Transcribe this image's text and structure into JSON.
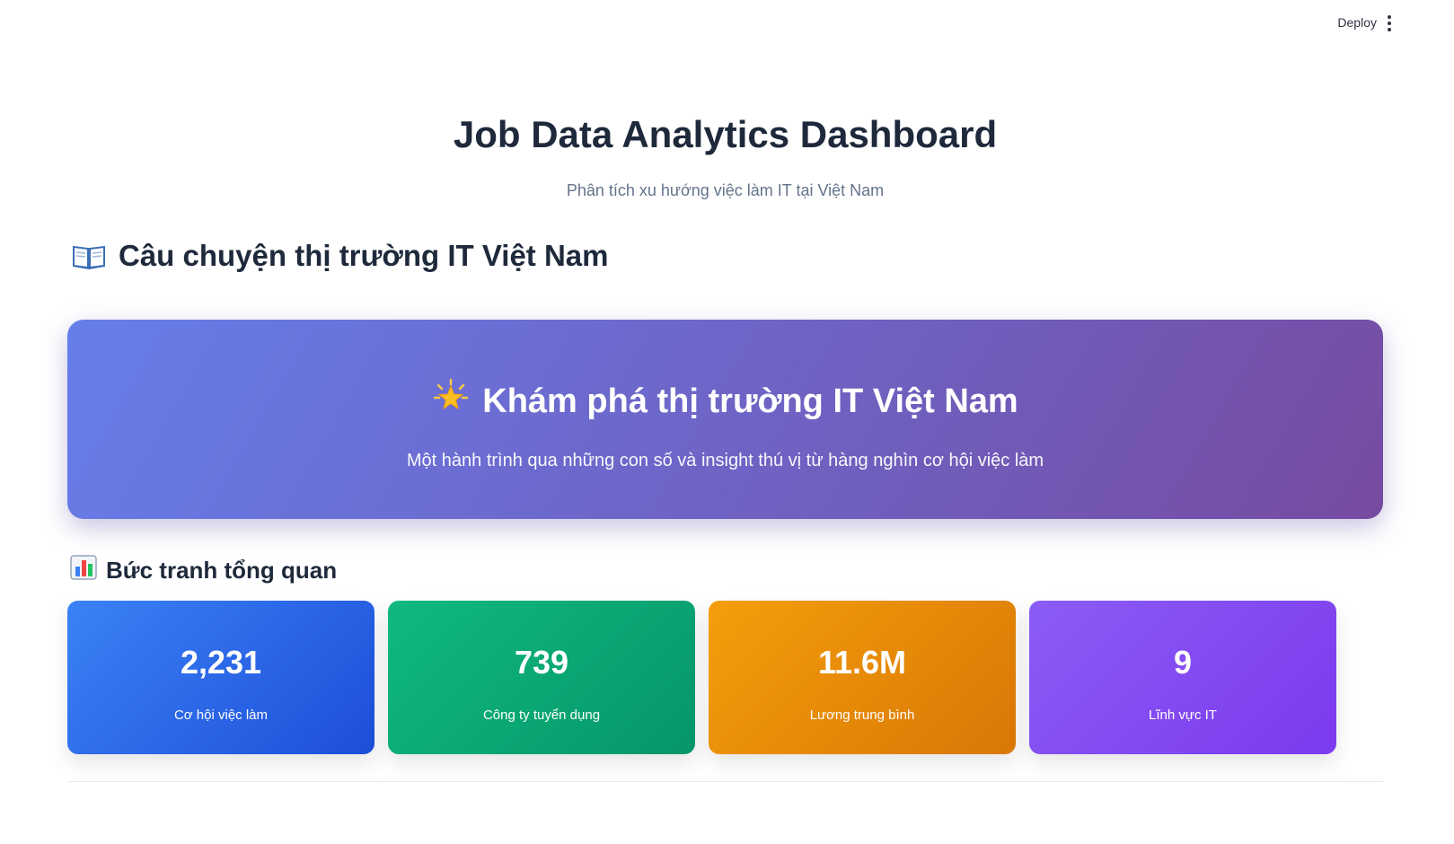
{
  "toolbar": {
    "deploy_label": "Deploy"
  },
  "header": {
    "title": "Job Data Analytics Dashboard",
    "subtitle": "Phân tích xu hướng việc làm IT tại Việt Nam"
  },
  "story_section": {
    "icon": "open-book-icon",
    "title": "Câu chuyện thị trường IT Việt Nam"
  },
  "hero": {
    "icon": "glowing-star-icon",
    "title": "Khám phá thị trường IT Việt Nam",
    "description": "Một hành trình qua những con số và insight thú vị từ hàng nghìn cơ hội việc làm",
    "gradient": [
      "#667eea",
      "#764ba2"
    ]
  },
  "overview": {
    "icon": "bar-chart-icon",
    "title": "Bức tranh tổng quan",
    "metrics": [
      {
        "value": "2,231",
        "label": "Cơ hội việc làm",
        "colors": [
          "#3b82f6",
          "#1d4ed8"
        ]
      },
      {
        "value": "739",
        "label": "Công ty tuyển dụng",
        "colors": [
          "#10b981",
          "#059669"
        ]
      },
      {
        "value": "11.6M",
        "label": "Lương trung bình",
        "colors": [
          "#f59e0b",
          "#d97706"
        ]
      },
      {
        "value": "9",
        "label": "Lĩnh vực IT",
        "colors": [
          "#8b5cf6",
          "#7c3aed"
        ]
      }
    ]
  }
}
